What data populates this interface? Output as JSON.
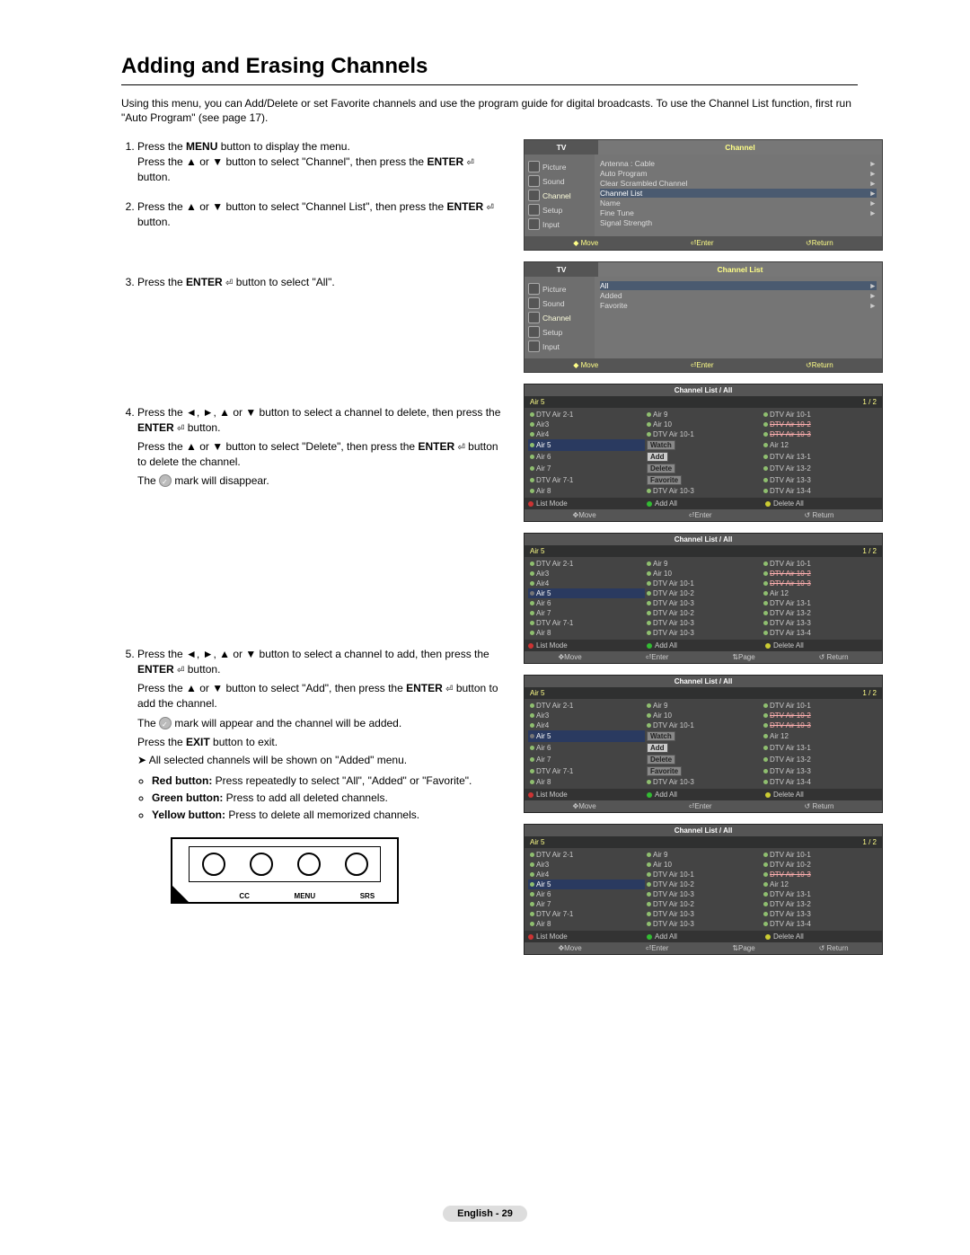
{
  "title": "Adding and Erasing Channels",
  "intro": "Using this menu, you can Add/Delete or set Favorite channels and use the program guide for digital broadcasts. To use the Channel List function, first run \"Auto Program\" (see page 17).",
  "steps": {
    "s1": {
      "a": "Press the ",
      "menu": "MENU",
      "b": " button to display the menu.",
      "c": "Press the ▲ or ▼ button to select \"Channel\", then press the ",
      "enter": "ENTER",
      "d": " button."
    },
    "s2": {
      "a": "Press the ▲ or ▼ button to select \"Channel List\", then press the ",
      "enter": "ENTER",
      "b": " button."
    },
    "s3": {
      "a": "Press the ",
      "enter": "ENTER",
      "b": " button to select \"All\"."
    },
    "s4": {
      "a": "Press the  ◄, ►, ▲ or ▼ button to select a channel to delete, then press the ",
      "enter": "ENTER",
      "b": " button.",
      "c": "Press the ▲ or ▼ button to select \"Delete\", then press the ",
      "d": " button to delete the channel.",
      "e": "The ",
      "f": " mark will disappear."
    },
    "s5": {
      "a": "Press the ◄, ►, ▲ or ▼ button to select a channel to add, then press the ",
      "enter": "ENTER",
      "b": " button.",
      "c": "Press the ▲ or ▼ button to select \"Add\", then press the ",
      "d": " button to add the channel.",
      "e": "The ",
      "f": " mark will appear and the channel will be added.",
      "g": "Press the ",
      "exit": "EXIT",
      "h": " button to exit.",
      "note": "All selected channels will be shown on \"Added\" menu.",
      "red": "Red button:",
      "redt": " Press repeatedly to select \"All\", \"Added\" or \"Favorite\".",
      "green": "Green button:",
      "greent": " Press to add all deleted channels.",
      "yellow": "Yellow button:",
      "yellowt": " Press to delete all memorized channels."
    }
  },
  "osd1": {
    "tv": "TV",
    "head": "Channel",
    "side": [
      "Picture",
      "Sound",
      "Channel",
      "Setup",
      "Input"
    ],
    "rows": [
      {
        "l": "Antenna",
        "r": ": Cable",
        "tri": "►"
      },
      {
        "l": "Auto Program",
        "tri": "►"
      },
      {
        "l": "Clear Scrambled Channel",
        "tri": "►"
      },
      {
        "l": "Channel List",
        "tri": "►",
        "hi": true
      },
      {
        "l": "Name",
        "tri": "►"
      },
      {
        "l": "Fine Tune",
        "tri": "►"
      },
      {
        "l": "Signal Strength"
      }
    ],
    "foot": {
      "move": "Move",
      "enter": "Enter",
      "return": "Return"
    }
  },
  "osd2": {
    "tv": "TV",
    "head": "Channel List",
    "side": [
      "Picture",
      "Sound",
      "Channel",
      "Setup",
      "Input"
    ],
    "rows": [
      {
        "l": "All",
        "tri": "►",
        "hi": true
      },
      {
        "l": "Added",
        "tri": "►"
      },
      {
        "l": "Favorite",
        "tri": "►"
      }
    ],
    "foot": {
      "move": "Move",
      "enter": "Enter",
      "return": "Return"
    }
  },
  "cl_common": {
    "title": "Channel List / All",
    "sub_l": "Air 5",
    "sub_r": "1 / 2",
    "col1": [
      "DTV Air 2-1",
      "Air3",
      "Air4",
      "Air 5",
      "Air 6",
      "Air 7",
      "DTV Air 7-1",
      "Air 8"
    ],
    "col2": [
      "Air 9",
      "Air 10",
      "DTV Air 10-1",
      "DTV Air 10-2",
      "DTV Air 10-3",
      "DTV Air 10-2",
      "DTV Air 10-3"
    ],
    "col3": [
      "DTV Air 10-1",
      "DTV Air 10-2",
      "DTV Air 10-3",
      "Air 12",
      "DTV Air 13-1",
      "DTV Air 13-2",
      "DTV Air 13-3",
      "DTV Air 13-4"
    ],
    "btns": {
      "list": "List Mode",
      "add": "Add All",
      "del": "Delete All"
    },
    "foot": {
      "move": "Move",
      "enter": "Enter",
      "page": "Page",
      "ret": "Return"
    }
  },
  "cl3_popup": {
    "watch": "Watch",
    "add": "Add",
    "delete": "Delete",
    "favorite": "Favorite"
  },
  "cl5_popup": {
    "watch": "Watch",
    "add": "Add",
    "delete": "Delete",
    "favorite": "Favorite"
  },
  "remote": {
    "labels": [
      "CC",
      "MENU",
      "SRS"
    ]
  },
  "page_foot": "English - 29"
}
